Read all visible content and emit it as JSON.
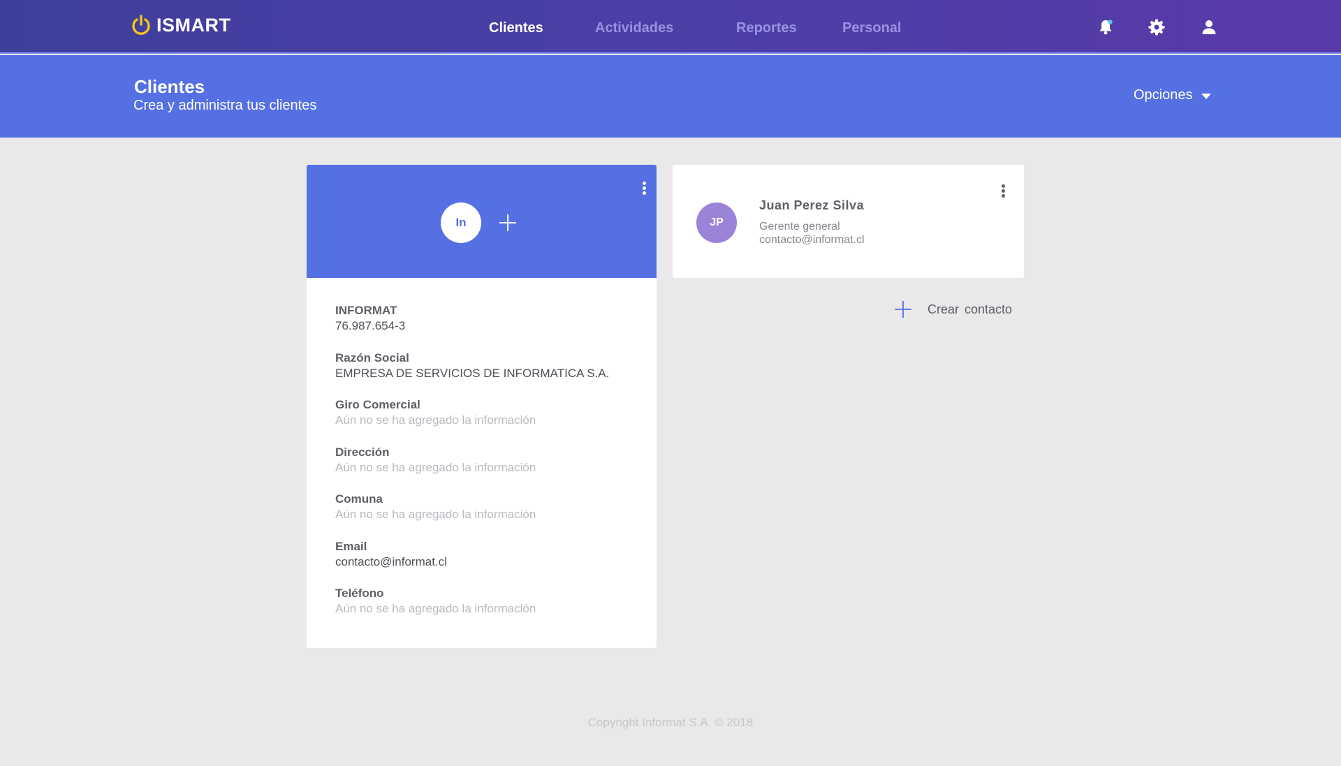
{
  "app": {
    "logo_text": "ISMART"
  },
  "nav": {
    "items": [
      {
        "label": "Clientes",
        "active": true
      },
      {
        "label": "Actividades",
        "active": false
      },
      {
        "label": "Reportes",
        "active": false
      },
      {
        "label": "Personal",
        "active": false
      }
    ],
    "icons": [
      "bell-icon",
      "gear-icon",
      "user-icon"
    ]
  },
  "header": {
    "title": "Clientes",
    "subtitle": "Crea y administra tus clientes",
    "options_label": "Opciones"
  },
  "client": {
    "avatar_initials": "In",
    "fields": [
      {
        "label": "INFORMAT",
        "value": "76.987.654-3",
        "empty": false
      },
      {
        "label": "Razón Social",
        "value": "EMPRESA DE SERVICIOS DE INFORMATICA S.A.",
        "empty": false
      },
      {
        "label": "Giro Comercial",
        "value": "Aún no se ha agregado la información",
        "empty": true
      },
      {
        "label": "Dirección",
        "value": "Aún no se ha agregado la información",
        "empty": true
      },
      {
        "label": "Comuna",
        "value": "Aún no se ha agregado la información",
        "empty": true
      },
      {
        "label": "Email",
        "value": "contacto@informat.cl",
        "empty": false
      },
      {
        "label": "Teléfono",
        "value": "Aún no se ha agregado la información",
        "empty": true
      }
    ]
  },
  "contact": {
    "avatar_initials": "JP",
    "name": "Juan Perez Silva",
    "role": "Gerente general",
    "email": "contacto@informat.cl"
  },
  "create_contact_label": "Crear contacto",
  "footer": "Copyright Informat S.A. © 2018",
  "colors": {
    "nav_gradient_start": "#3e3f9c",
    "nav_gradient_end": "#5a3aa8",
    "primary_blue": "#5570e3",
    "logo_yellow": "#f5c518",
    "contact_avatar": "#9b84d8",
    "background": "#e9e9ea"
  }
}
